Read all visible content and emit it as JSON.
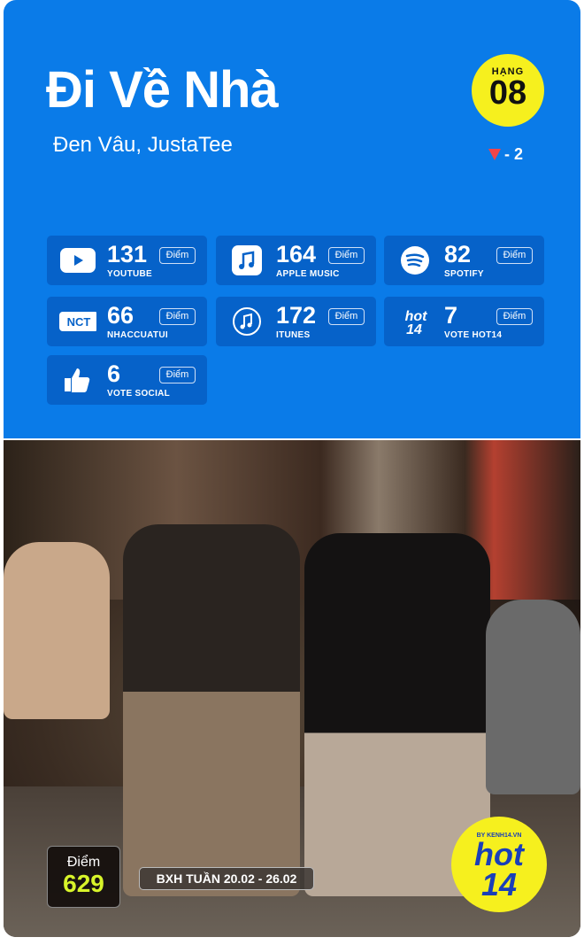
{
  "song": {
    "title": "Đi Về Nhà",
    "artists": "Đen Vâu, JustaTee"
  },
  "rank": {
    "label": "HẠNG",
    "value": "08",
    "change": "- 2",
    "direction": "down"
  },
  "points_label": "Điểm",
  "platforms": [
    {
      "name": "YOUTUBE",
      "score": "131",
      "icon": "youtube-icon"
    },
    {
      "name": "APPLE MUSIC",
      "score": "164",
      "icon": "apple-music-icon"
    },
    {
      "name": "SPOTIFY",
      "score": "82",
      "icon": "spotify-icon"
    },
    {
      "name": "NHACCUATUI",
      "score": "66",
      "icon": "nct-icon"
    },
    {
      "name": "ITUNES",
      "score": "172",
      "icon": "itunes-icon"
    },
    {
      "name": "VOTE HOT14",
      "score": "7",
      "icon": "hot14-icon"
    },
    {
      "name": "VOTE SOCIAL",
      "score": "6",
      "icon": "thumbs-up-icon"
    }
  ],
  "total": {
    "label": "Điểm",
    "value": "629"
  },
  "week": "BXH TUẦN 20.02 - 26.02",
  "logo": {
    "text": "hot14",
    "tagline": "BY KENH14.VN"
  },
  "colors": {
    "panel": "#0a7be8",
    "card": "#0662c9",
    "badge": "#f6f01e",
    "score": "#d8f42a",
    "down": "#f0454a"
  }
}
